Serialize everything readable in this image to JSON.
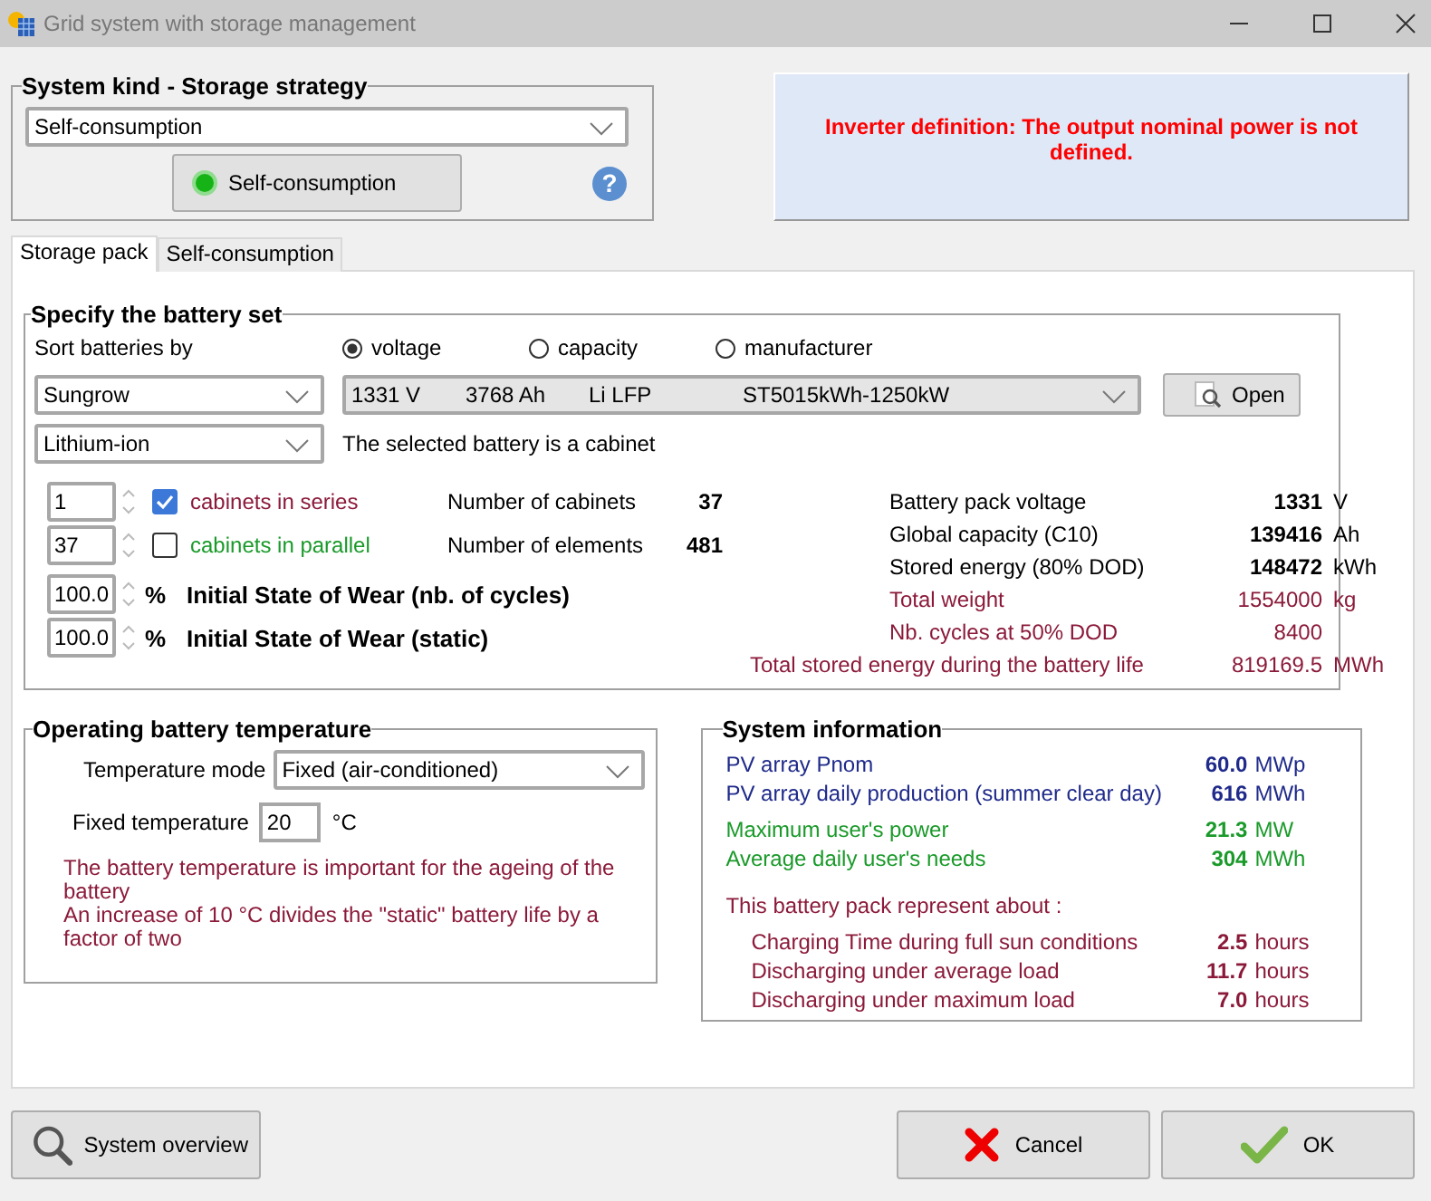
{
  "window": {
    "title": "Grid system with storage management"
  },
  "system_kind": {
    "title": "System kind - Storage strategy",
    "strategy": "Self-consumption",
    "strategy_button": "Self-consumption",
    "help": "?"
  },
  "alert": "Inverter definition: The output nominal power is not defined.",
  "tabs": [
    {
      "label": "Storage pack",
      "selected": true
    },
    {
      "label": "Self-consumption",
      "selected": false
    }
  ],
  "battery_set": {
    "title": "Specify the battery set",
    "sort_label": "Sort batteries by",
    "sort_options": [
      {
        "label": "voltage",
        "selected": true
      },
      {
        "label": "capacity",
        "selected": false
      },
      {
        "label": "manufacturer",
        "selected": false
      }
    ],
    "manufacturer": "Sungrow",
    "technology": "Lithium-ion",
    "battery": {
      "voltage": "1331 V",
      "capacity": "3768 Ah",
      "chemistry": "Li  LFP",
      "model": "ST5015kWh-1250kW"
    },
    "open_button": "Open",
    "note": "The selected battery is a cabinet",
    "arrangement": [
      {
        "value": "1",
        "label": "cabinets in series",
        "checked": true,
        "count_label": "Number of cabinets",
        "count": "37"
      },
      {
        "value": "37",
        "label": "cabinets in parallel",
        "checked": false,
        "count_label": "Number of elements",
        "count": "481"
      }
    ],
    "wear": [
      {
        "value": "100.0",
        "unit": "%",
        "label": "Initial State of Wear (nb. of cycles)"
      },
      {
        "value": "100.0",
        "unit": "%",
        "label": "Initial State of Wear (static)"
      }
    ],
    "pack": [
      {
        "label": "Battery pack voltage",
        "value": "1331",
        "unit": "V",
        "kind": "main"
      },
      {
        "label": "Global capacity (C10)",
        "value": "139416",
        "unit": "Ah",
        "kind": "main"
      },
      {
        "label": "Stored energy (80% DOD)",
        "value": "148472",
        "unit": "kWh",
        "kind": "main"
      },
      {
        "label": "Total weight",
        "value": "1554000",
        "unit": "kg",
        "kind": "secondary"
      },
      {
        "label": "Nb. cycles at 50% DOD",
        "value": "8400",
        "kind": "secondary"
      },
      {
        "label": "Total stored energy during the battery life",
        "value": "819169.5",
        "unit": "MWh",
        "kind": "total"
      }
    ]
  },
  "temperature": {
    "title": "Operating battery temperature",
    "mode_label": "Temperature mode",
    "mode": "Fixed (air-conditioned)",
    "fixed_label": "Fixed temperature",
    "fixed_value": "20",
    "unit": "°C",
    "notes": [
      "The battery temperature is important for the ageing of the battery",
      "An increase of 10 °C divides the \"static\" battery life by a factor of two"
    ]
  },
  "system_info": {
    "title": "System information",
    "rows": [
      {
        "kind": "pv",
        "label": "PV array Pnom",
        "value": "60.0",
        "unit": "MWp"
      },
      {
        "kind": "pv",
        "label": "PV array daily production (summer clear day)",
        "value": "616",
        "unit": "MWh"
      },
      {
        "kind": "user",
        "label": "Maximum user's power",
        "value": "21.3",
        "unit": "MW"
      },
      {
        "kind": "user",
        "label": "Average daily user's needs",
        "value": "304",
        "unit": "MWh"
      },
      {
        "kind": "heading",
        "label": "This battery pack represent about :"
      },
      {
        "kind": "pack",
        "label": "Charging Time during full sun conditions",
        "value": "2.5",
        "unit": "hours"
      },
      {
        "kind": "pack",
        "label": "Discharging under average load",
        "value": "11.7",
        "unit": "hours"
      },
      {
        "kind": "pack",
        "label": "Discharging under maximum load",
        "value": "7.0",
        "unit": "hours"
      }
    ]
  },
  "buttons": {
    "overview": "System overview",
    "cancel": "Cancel",
    "ok": "OK"
  }
}
